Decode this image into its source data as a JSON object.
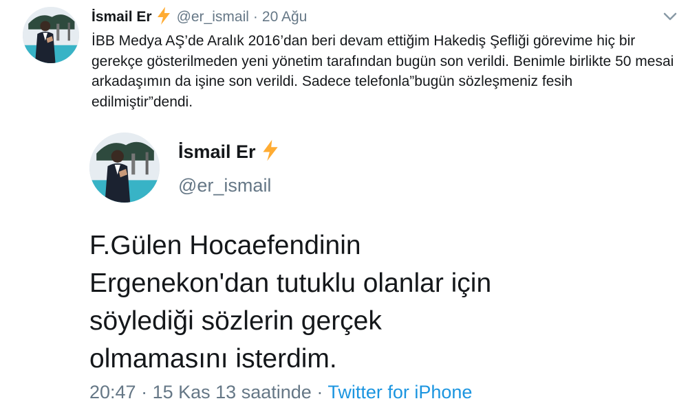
{
  "tweet": {
    "author_name": "İsmail Er",
    "handle": "@er_ismail",
    "separator": "·",
    "date": "20 Ağu",
    "text": "İBB Medya AŞ’de Aralık 2016’dan beri devam ettiğim Hakediş Şefliği görevime hiç bir gerekçe gösterilmeden yeni yönetim tarafından bugün son verildi. Benimle birlikte 50 mesai arkadaşımın da işine son verildi. Sadece telefonla”bugün sözleşmeniz fesih edilmiştir”dendi.",
    "menu_icon": "chevron-down-icon",
    "badge_icon": "lightning-bolt-icon"
  },
  "quoted_tweet": {
    "author_name": "İsmail Er",
    "handle": "@er_ismail",
    "text": "F.Gülen Hocaefendinin Ergenekon'dan tutuklu olanlar için söylediği sözlerin gerçek olmamasını isterdim.",
    "time": "20:47",
    "separator": "·",
    "relative": "15 Kas 13 saatinde",
    "source": "Twitter for iPhone",
    "badge_icon": "lightning-bolt-icon"
  },
  "colors": {
    "text": "#14171a",
    "muted": "#657786",
    "link": "#1b95e0",
    "bolt": "#ffac33"
  }
}
